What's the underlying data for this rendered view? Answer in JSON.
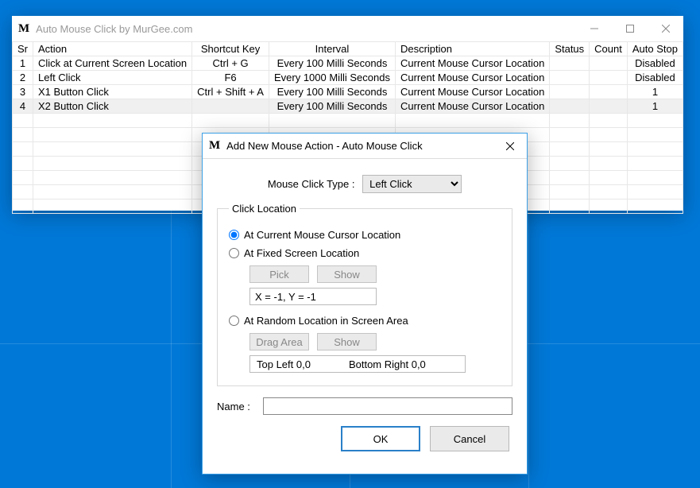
{
  "main_window": {
    "title": "Auto Mouse Click by MurGee.com",
    "columns": [
      "Sr",
      "Action",
      "Shortcut Key",
      "Interval",
      "Description",
      "Status",
      "Count",
      "Auto Stop"
    ],
    "rows": [
      {
        "sr": "1",
        "action": "Click at Current Screen Location",
        "shortcut": "Ctrl + G",
        "interval": "Every 100 Milli Seconds",
        "desc": "Current Mouse Cursor Location",
        "status": "",
        "count": "",
        "autostop": "Disabled"
      },
      {
        "sr": "2",
        "action": "Left Click",
        "shortcut": "F6",
        "interval": "Every 1000 Milli Seconds",
        "desc": "Current Mouse Cursor Location",
        "status": "",
        "count": "",
        "autostop": "Disabled"
      },
      {
        "sr": "3",
        "action": "X1 Button Click",
        "shortcut": "Ctrl + Shift + A",
        "interval": "Every 100 Milli Seconds",
        "desc": "Current Mouse Cursor Location",
        "status": "",
        "count": "",
        "autostop": "1"
      },
      {
        "sr": "4",
        "action": "X2 Button Click",
        "shortcut": "",
        "interval": "Every 100 Milli Seconds",
        "desc": "Current Mouse Cursor Location",
        "status": "",
        "count": "",
        "autostop": "1"
      }
    ]
  },
  "dialog": {
    "title": "Add New Mouse Action - Auto Mouse Click",
    "click_type_label": "Mouse Click Type :",
    "click_type_value": "Left Click",
    "location_legend": "Click Location",
    "radio_current": "At Current Mouse Cursor Location",
    "radio_fixed": "At Fixed Screen Location",
    "pick_btn": "Pick",
    "show_btn": "Show",
    "xy_value": "X = -1, Y = -1",
    "radio_random": "At Random Location in Screen Area",
    "drag_btn": "Drag Area",
    "rand_topleft": "Top Left 0,0",
    "rand_botright": "Bottom Right 0,0",
    "name_label": "Name :",
    "name_value": "",
    "ok": "OK",
    "cancel": "Cancel"
  }
}
